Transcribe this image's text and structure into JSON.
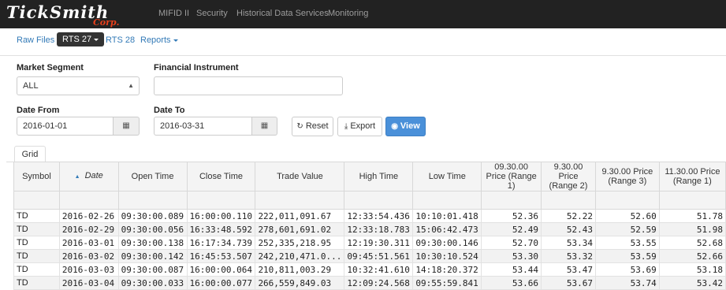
{
  "brand": {
    "name_top": "TickSmith",
    "name_bottom": "Corp."
  },
  "nav": {
    "items": [
      "MIFID II",
      "Security",
      "Historical Data Services",
      "Monitoring"
    ]
  },
  "subnav": {
    "items": [
      "Raw Files",
      "RTS 27",
      "RTS 28",
      "Reports"
    ],
    "active": "RTS 27"
  },
  "form": {
    "market_segment": {
      "label": "Market Segment",
      "value": "ALL"
    },
    "financial_instrument": {
      "label": "Financial Instrument",
      "value": ""
    },
    "date_from": {
      "label": "Date From",
      "value": "2016-01-01"
    },
    "date_to": {
      "label": "Date To",
      "value": "2016-03-31"
    },
    "buttons": {
      "reset": "Reset",
      "export": "Export",
      "view": "View"
    }
  },
  "grid": {
    "tab_label": "Grid",
    "columns": [
      "Symbol",
      "Date",
      "Open Time",
      "Close Time",
      "Trade Value",
      "High Time",
      "Low Time",
      "09.30.00 Price (Range 1)",
      "9.30.00 Price (Range 2)",
      "9.30.00 Price (Range 3)",
      "11.30.00 Price (Range 1)"
    ],
    "rows": [
      [
        "TD",
        "2016-02-26",
        "09:30:00.089",
        "16:00:00.110",
        "222,011,091.67",
        "12:33:54.436",
        "10:10:01.418",
        "52.36",
        "52.22",
        "52.60",
        "51.78"
      ],
      [
        "TD",
        "2016-02-29",
        "09:30:00.056",
        "16:33:48.592",
        "278,601,691.02",
        "12:33:18.783",
        "15:06:42.473",
        "52.49",
        "52.43",
        "52.59",
        "51.98"
      ],
      [
        "TD",
        "2016-03-01",
        "09:30:00.138",
        "16:17:34.739",
        "252,335,218.95",
        "12:19:30.311",
        "09:30:00.146",
        "52.70",
        "53.34",
        "53.55",
        "52.68"
      ],
      [
        "TD",
        "2016-03-02",
        "09:30:00.142",
        "16:45:53.507",
        "242,210,471.0...",
        "09:45:51.561",
        "10:30:10.524",
        "53.30",
        "53.32",
        "53.59",
        "52.66"
      ],
      [
        "TD",
        "2016-03-03",
        "09:30:00.087",
        "16:00:00.064",
        "210,811,003.29",
        "10:32:41.610",
        "14:18:20.372",
        "53.44",
        "53.47",
        "53.69",
        "53.18"
      ],
      [
        "TD",
        "2016-03-04",
        "09:30:00.033",
        "16:00:00.077",
        "266,559,849.03",
        "12:09:24.568",
        "09:55:59.841",
        "53.66",
        "53.67",
        "53.74",
        "53.42"
      ]
    ]
  },
  "colors": {
    "navbar": "#222222",
    "brand_accent": "#e8401c",
    "link": "#337ab7",
    "primary_button": "#4a90d9"
  }
}
